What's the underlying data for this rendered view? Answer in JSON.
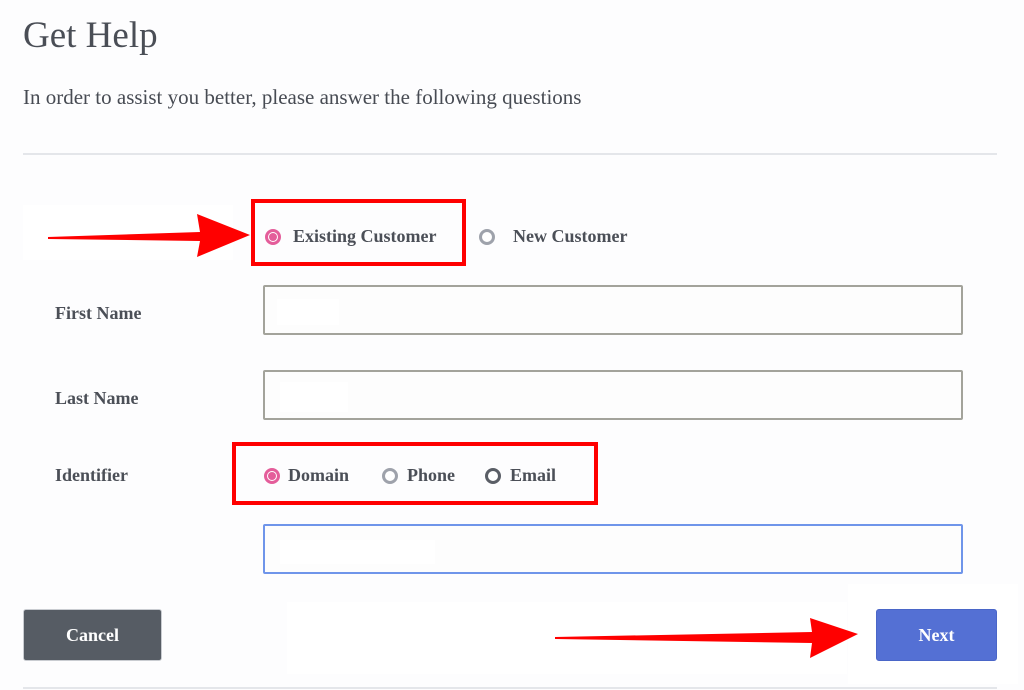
{
  "header": {
    "title": "Get Help",
    "subtitle": "In order to assist you better, please answer the following questions"
  },
  "customer_type": {
    "options": [
      {
        "label": "Existing Customer",
        "selected": true
      },
      {
        "label": "New Customer",
        "selected": false
      }
    ]
  },
  "form": {
    "first_name": {
      "label": "First Name",
      "value": ""
    },
    "last_name": {
      "label": "Last Name",
      "value": ""
    },
    "identifier": {
      "label": "Identifier",
      "options": [
        {
          "label": "Domain",
          "selected": true
        },
        {
          "label": "Phone",
          "selected": false
        },
        {
          "label": "Email",
          "selected": false
        }
      ],
      "value": ""
    }
  },
  "buttons": {
    "cancel_label": "Cancel",
    "next_label": "Next"
  },
  "colors": {
    "accent_radio": "#e45d9a",
    "next_button": "#5470d4",
    "cancel_button": "#565c64",
    "annotation_red": "#ff0000",
    "focus_border": "#6f95ea"
  }
}
